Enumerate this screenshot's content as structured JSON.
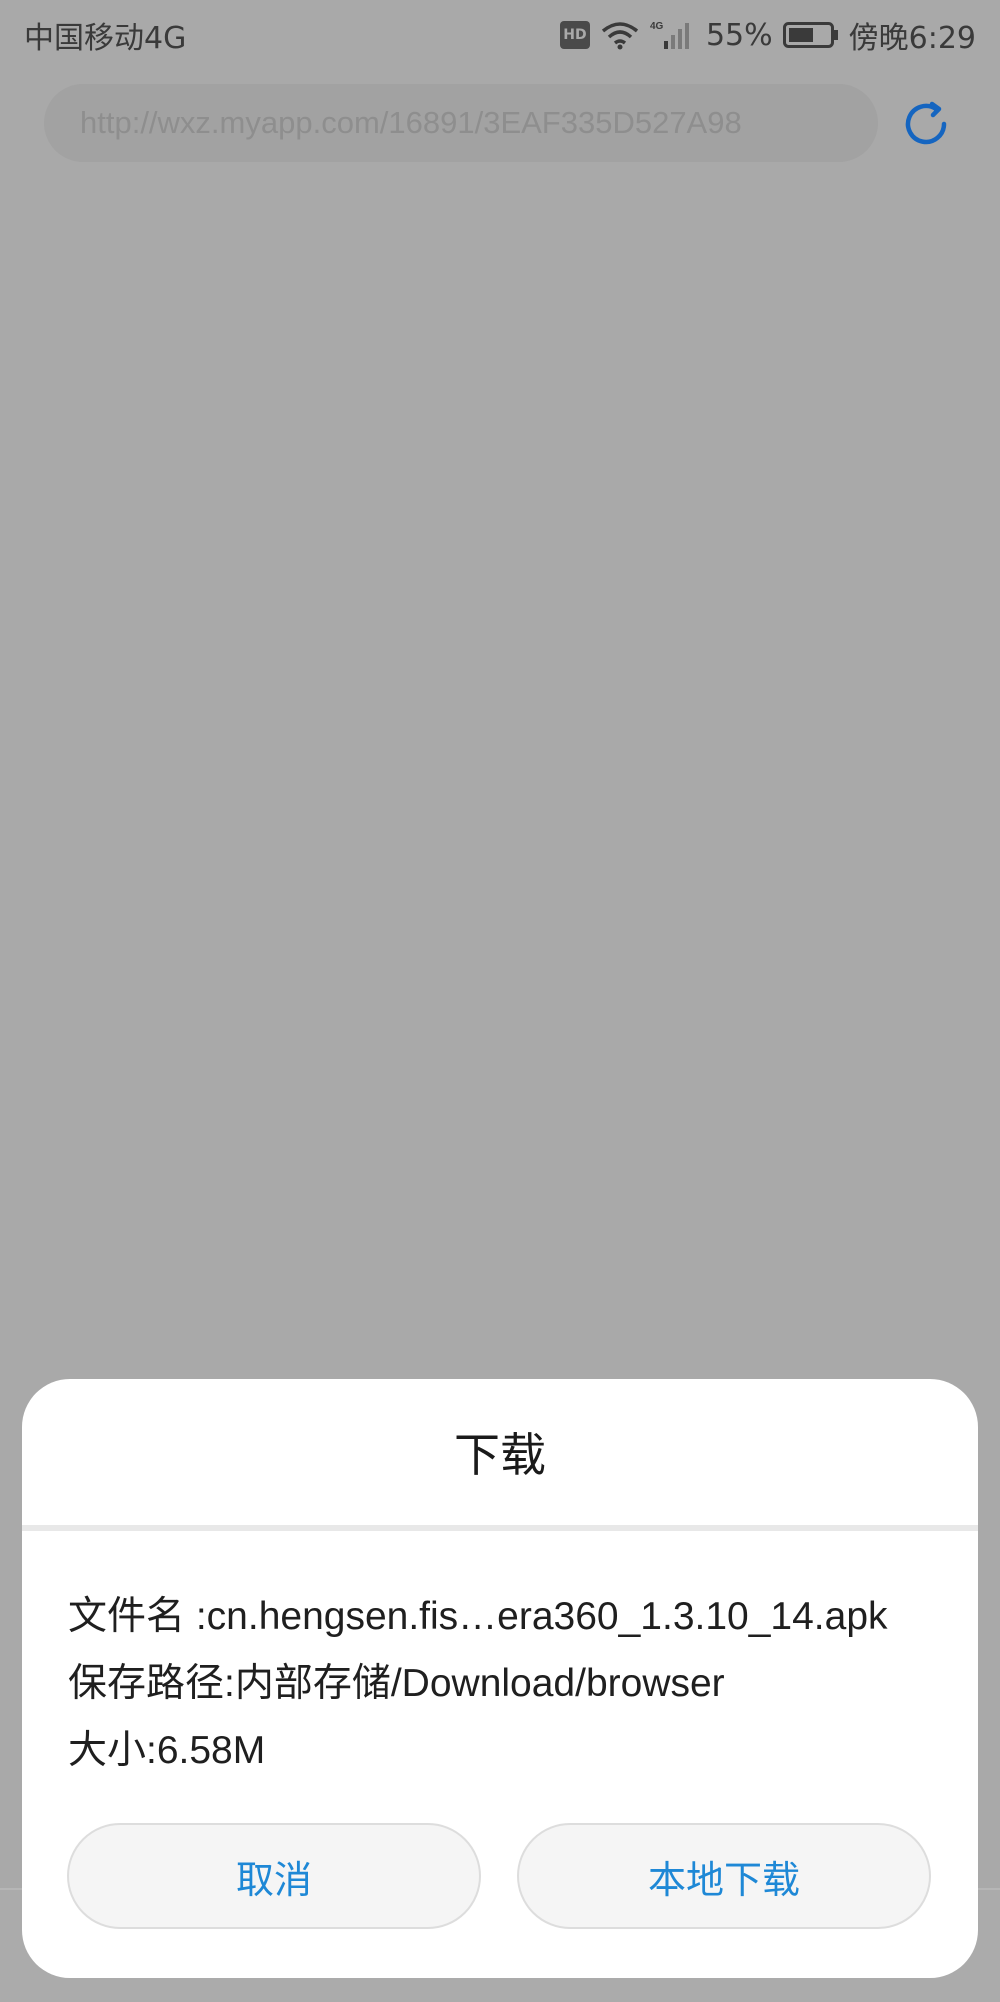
{
  "status_bar": {
    "carrier": "中国移动4G",
    "hd": "HD",
    "network": "4G",
    "battery_percent": "55%",
    "time": "傍晚6:29"
  },
  "address_bar": {
    "url": "http://wxz.myapp.com/16891/3EAF335D527A98"
  },
  "dialog": {
    "title": "下载",
    "file_name": "文件名 :cn.hengsen.fis…era360_1.3.10_14.apk",
    "save_path": "保存路径:内部存储/Download/browser",
    "size": "大小:6.58M",
    "cancel_label": "取消",
    "download_label": "本地下载"
  },
  "colors": {
    "accent": "#1e88d6",
    "overlay": "#a9a9a9"
  },
  "icons": [
    "wifi-icon",
    "signal-icon",
    "battery-icon",
    "refresh-icon"
  ]
}
